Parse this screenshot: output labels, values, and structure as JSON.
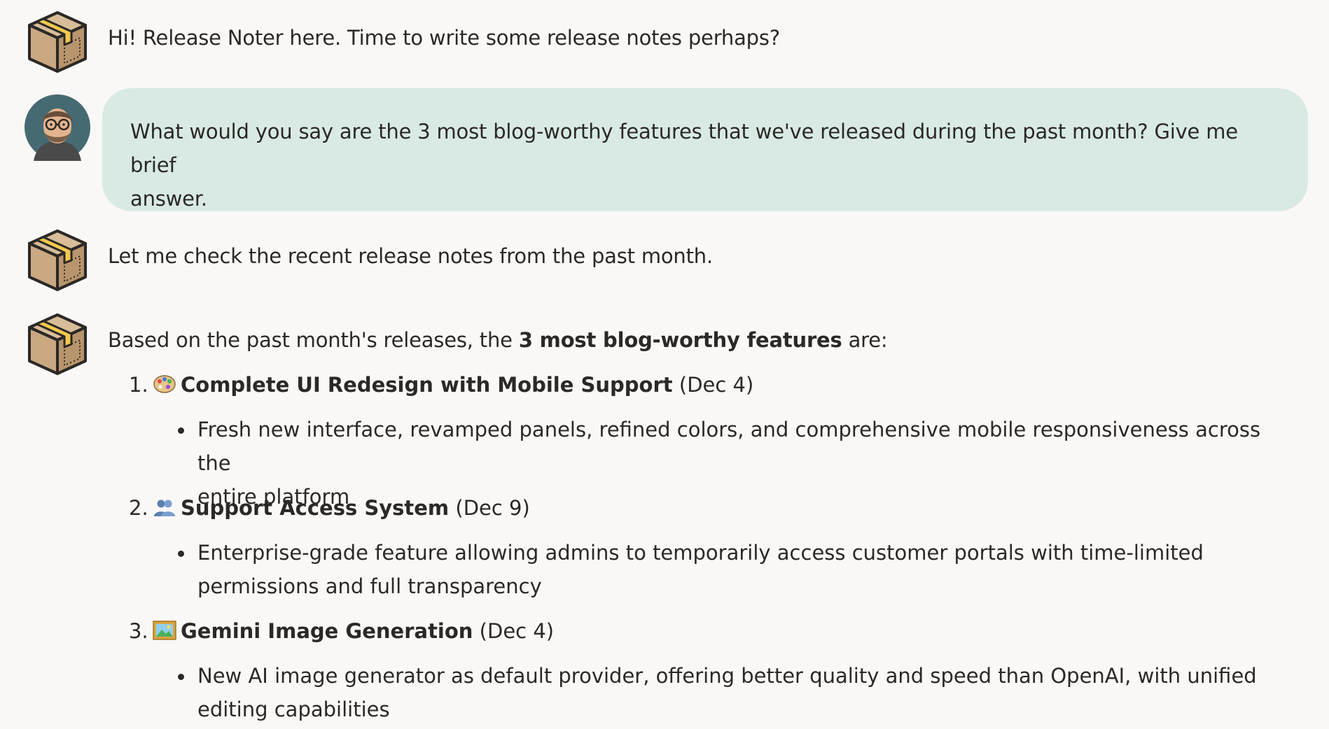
{
  "messages": {
    "greeting": "Hi! Release Noter here. Time to write some release notes perhaps?",
    "user_question_line1": "What would you say are the 3 most blog-worthy features that we've released during the past month? Give me brief",
    "user_question_line2": "answer.",
    "checking": "Let me check the recent release notes from the past month.",
    "answer_intro_pre": "Based on the past month's releases, the ",
    "answer_intro_bold": "3 most blog-worthy features",
    "answer_intro_post": " are:"
  },
  "features": [
    {
      "number": "1.",
      "icon": "palette-icon",
      "title": "Complete UI Redesign with Mobile Support",
      "date": "(Dec 4)",
      "detail_line1": "Fresh new interface, revamped panels, refined colors, and comprehensive mobile responsiveness across the",
      "detail_line2": "entire platform"
    },
    {
      "number": "2.",
      "icon": "people-icon",
      "title": "Support Access System",
      "date": "(Dec 9)",
      "detail_line1": "Enterprise-grade feature allowing admins to temporarily access customer portals with time-limited",
      "detail_line2": "permissions and full transparency"
    },
    {
      "number": "3.",
      "icon": "framed-picture-icon",
      "title": "Gemini Image Generation",
      "date": "(Dec 4)",
      "detail_line1": "New AI image generator as default provider, offering better quality and speed than OpenAI, with unified",
      "detail_line2": "editing capabilities"
    }
  ],
  "colors": {
    "background": "#f9f8f7",
    "user_bubble": "#d9eae4",
    "text": "#2b2826",
    "box_brown": "#c9a882",
    "tape_yellow": "#f2c94c"
  }
}
